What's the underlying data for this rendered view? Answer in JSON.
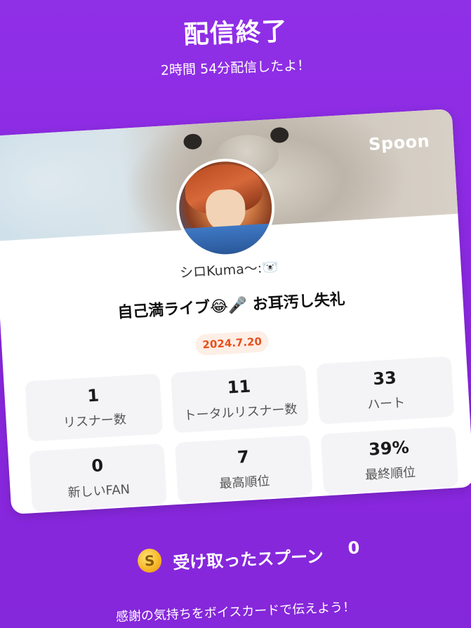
{
  "header": {
    "title": "配信終了",
    "duration_text": "2時間 54分配信したよ！"
  },
  "card": {
    "brand": "Spoon",
    "username": "シロKuma〜:🐻‍❄️",
    "stream_title": "自己満ライブ😂🎤 お耳汚し失礼",
    "date": "2024.7.20",
    "stats": [
      {
        "value": "1",
        "label": "リスナー数"
      },
      {
        "value": "11",
        "label": "トータルリスナー数"
      },
      {
        "value": "33",
        "label": "ハート"
      },
      {
        "value": "0",
        "label": "新しいFAN"
      },
      {
        "value": "7",
        "label": "最高順位"
      },
      {
        "value": "39%",
        "label": "最終順位"
      }
    ]
  },
  "footer": {
    "coin_symbol": "S",
    "spoons_label": "受け取ったスプーン",
    "spoons_count": "0",
    "thanks_text": "感謝の気持ちをボイスカードで伝えよう！"
  },
  "colors": {
    "background": "#8a2be2",
    "card": "#ffffff",
    "date_badge_text": "#e8501c",
    "date_badge_bg": "#fdeee6",
    "stat_bg": "#f4f4f6"
  },
  "icons": {
    "coin": "spoon-coin-icon",
    "avatar": "user-avatar"
  }
}
